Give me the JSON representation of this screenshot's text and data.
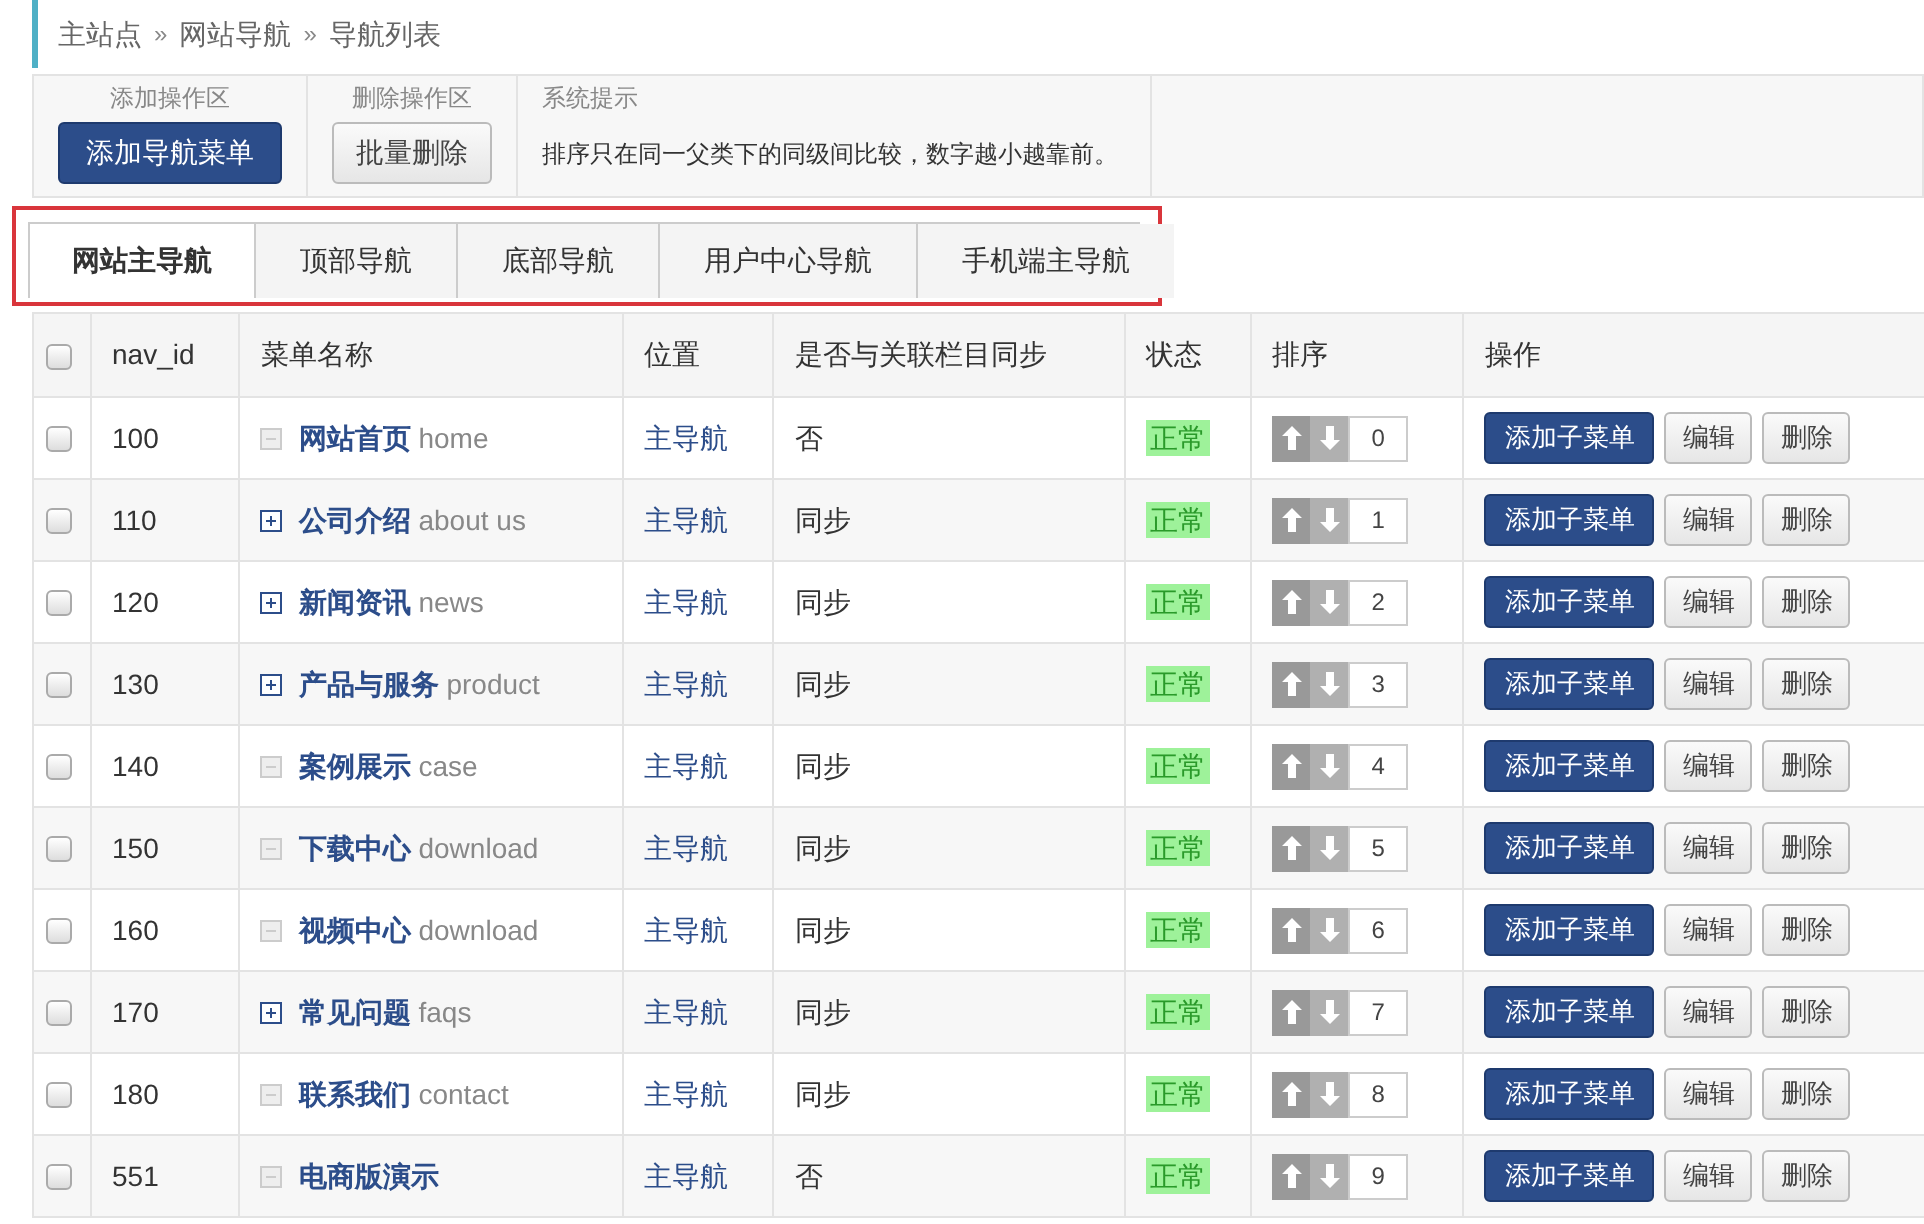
{
  "breadcrumb": [
    "主站点",
    "网站导航",
    "导航列表"
  ],
  "breadcrumb_separator": "»",
  "toolbar": [
    {
      "label": "添加操作区",
      "kind": "primary",
      "button": "添加导航菜单"
    },
    {
      "label": "删除操作区",
      "kind": "default",
      "button": "批量删除"
    },
    {
      "label": "系统提示",
      "kind": "note",
      "text": "排序只在同一父类下的同级间比较，数字越小越靠前。"
    }
  ],
  "tabs": [
    {
      "label": "网站主导航",
      "selected": true
    },
    {
      "label": "顶部导航",
      "selected": false
    },
    {
      "label": "底部导航",
      "selected": false
    },
    {
      "label": "用户中心导航",
      "selected": false
    },
    {
      "label": "手机端主导航",
      "selected": false
    }
  ],
  "table": {
    "columns": [
      "nav_id",
      "菜单名称",
      "位置",
      "是否与关联栏目同步",
      "状态",
      "排序",
      "操作"
    ],
    "select_all_checked": false,
    "row_actions": [
      [
        "添加子菜单",
        "编辑",
        "删除"
      ],
      [
        "添加子菜单",
        "编辑",
        "删除"
      ],
      [
        "添加子菜单",
        "编辑",
        "删除"
      ],
      [
        "添加子菜单",
        "编辑",
        "删除"
      ],
      [
        "添加子菜单",
        "编辑",
        "删除"
      ],
      [
        "添加子菜单",
        "编辑",
        "删除"
      ],
      [
        "添加子菜单",
        "编辑",
        "删除"
      ],
      [
        "添加子菜单",
        "编辑",
        "删除"
      ],
      [
        "添加子菜单",
        "编辑",
        "删除"
      ],
      [
        "添加子菜单",
        "编辑",
        "删除"
      ]
    ],
    "rows": [
      {
        "checked": false,
        "id": "100",
        "expandable": false,
        "name": "网站首页",
        "alias": "home",
        "position": "主导航",
        "sync": "否",
        "status": "正常",
        "order": "0"
      },
      {
        "checked": false,
        "id": "110",
        "expandable": true,
        "name": "公司介绍",
        "alias": "about us",
        "position": "主导航",
        "sync": "同步",
        "status": "正常",
        "order": "1"
      },
      {
        "checked": false,
        "id": "120",
        "expandable": true,
        "name": "新闻资讯",
        "alias": "news",
        "position": "主导航",
        "sync": "同步",
        "status": "正常",
        "order": "2"
      },
      {
        "checked": false,
        "id": "130",
        "expandable": true,
        "name": "产品与服务",
        "alias": "product",
        "position": "主导航",
        "sync": "同步",
        "status": "正常",
        "order": "3"
      },
      {
        "checked": false,
        "id": "140",
        "expandable": false,
        "name": "案例展示",
        "alias": "case",
        "position": "主导航",
        "sync": "同步",
        "status": "正常",
        "order": "4"
      },
      {
        "checked": false,
        "id": "150",
        "expandable": false,
        "name": "下载中心",
        "alias": "download",
        "position": "主导航",
        "sync": "同步",
        "status": "正常",
        "order": "5"
      },
      {
        "checked": false,
        "id": "160",
        "expandable": false,
        "name": "视频中心",
        "alias": "download",
        "position": "主导航",
        "sync": "同步",
        "status": "正常",
        "order": "6"
      },
      {
        "checked": false,
        "id": "170",
        "expandable": true,
        "name": "常见问题",
        "alias": "faqs",
        "position": "主导航",
        "sync": "同步",
        "status": "正常",
        "order": "7"
      },
      {
        "checked": false,
        "id": "180",
        "expandable": false,
        "name": "联系我们",
        "alias": "contact",
        "position": "主导航",
        "sync": "同步",
        "status": "正常",
        "order": "8"
      },
      {
        "checked": false,
        "id": "551",
        "expandable": false,
        "name": "电商版演示",
        "position": "主导航",
        "sync": "否",
        "status": "正常",
        "order": "9"
      }
    ]
  }
}
